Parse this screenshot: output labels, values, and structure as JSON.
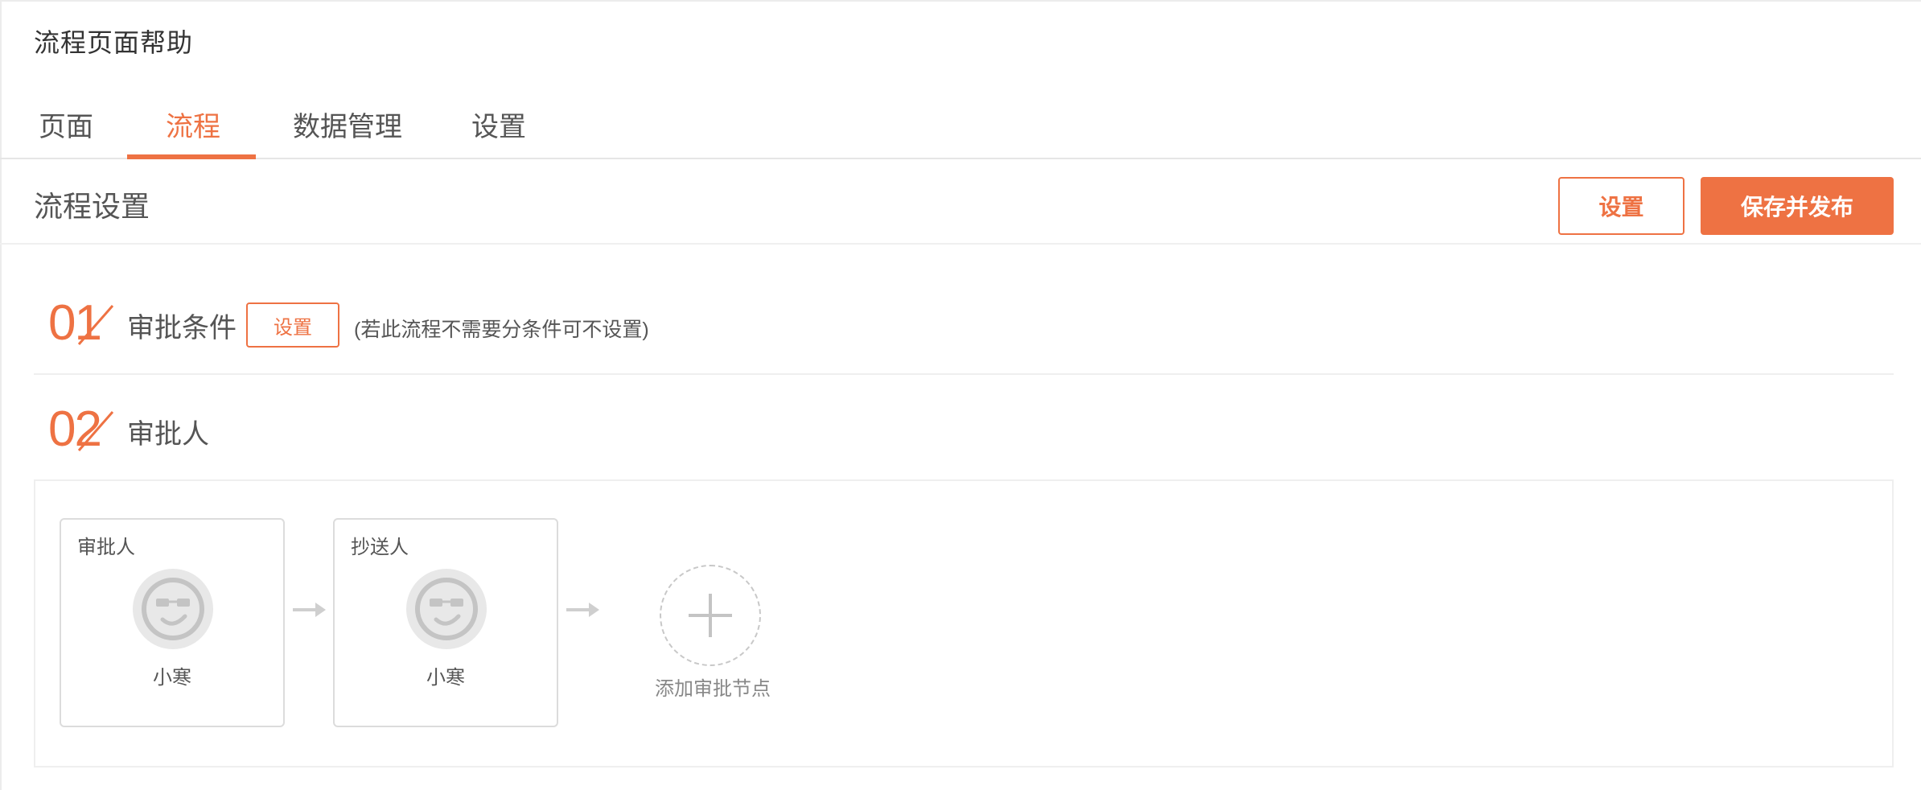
{
  "app": {
    "title": "流程页面帮助"
  },
  "tabs": [
    {
      "label": "页面"
    },
    {
      "label": "流程",
      "active": true
    },
    {
      "label": "数据管理"
    },
    {
      "label": "设置"
    }
  ],
  "section": {
    "title": "流程设置",
    "settings_button": "设置",
    "publish_button": "保存并发布"
  },
  "steps": [
    {
      "number": "01",
      "label": "审批条件",
      "button": "设置",
      "hint": "(若此流程不需要分条件可不设置)"
    },
    {
      "number": "02",
      "label": "审批人"
    }
  ],
  "flow": {
    "nodes": [
      {
        "type": "审批人",
        "name": "小寒",
        "icon": "avatar-smiley-icon"
      },
      {
        "type": "抄送人",
        "name": "小寒",
        "icon": "avatar-smiley-icon"
      }
    ],
    "add_label": "添加审批节点"
  },
  "colors": {
    "accent": "#ee7243",
    "border": "#dcdcdc",
    "avatar_bg": "#e8e8e8",
    "avatar_stroke": "#c4c4c4"
  }
}
